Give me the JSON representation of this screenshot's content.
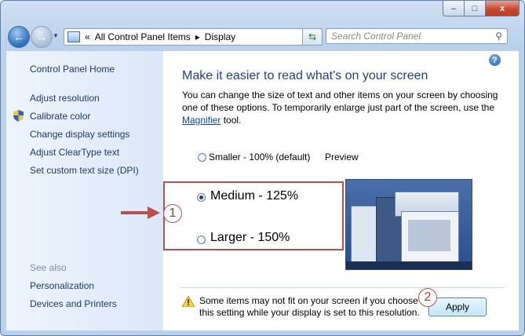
{
  "window": {
    "min_label": "–",
    "max_label": "□",
    "close_label": "x"
  },
  "nav": {
    "back_icon": "←",
    "forward_icon": "→"
  },
  "address": {
    "prefix": "«",
    "segments": [
      "All Control Panel Items",
      "Display"
    ],
    "separator": "▸"
  },
  "search": {
    "placeholder": "Search Control Panel"
  },
  "sidebar": {
    "home": "Control Panel Home",
    "links": [
      "Adjust resolution",
      "Calibrate color",
      "Change display settings",
      "Adjust ClearType text",
      "Set custom text size (DPI)"
    ],
    "see_also_label": "See also",
    "see_also": [
      "Personalization",
      "Devices and Printers"
    ]
  },
  "main": {
    "help_label": "?",
    "title": "Make it easier to read what's on your screen",
    "description_before_link": "You can change the size of text and other items on your screen by choosing one of these options. To temporarily enlarge just part of the screen, use the ",
    "link_text": "Magnifier",
    "description_after_link": " tool.",
    "options": [
      {
        "label": "Smaller - 100% (default)",
        "selected": false
      },
      {
        "label": "Medium - 125%",
        "selected": true
      },
      {
        "label": "Larger - 150%",
        "selected": false
      }
    ],
    "preview_label": "Preview",
    "warning_text": "Some items may not fit on your screen if you choose this setting while your display is set to this resolution.",
    "apply_label": "Apply"
  },
  "annotations": {
    "step1": "1",
    "step2": "2"
  },
  "colors": {
    "accent": "#1e3f8a",
    "link": "#0645ad",
    "annotation": "#b85050"
  }
}
